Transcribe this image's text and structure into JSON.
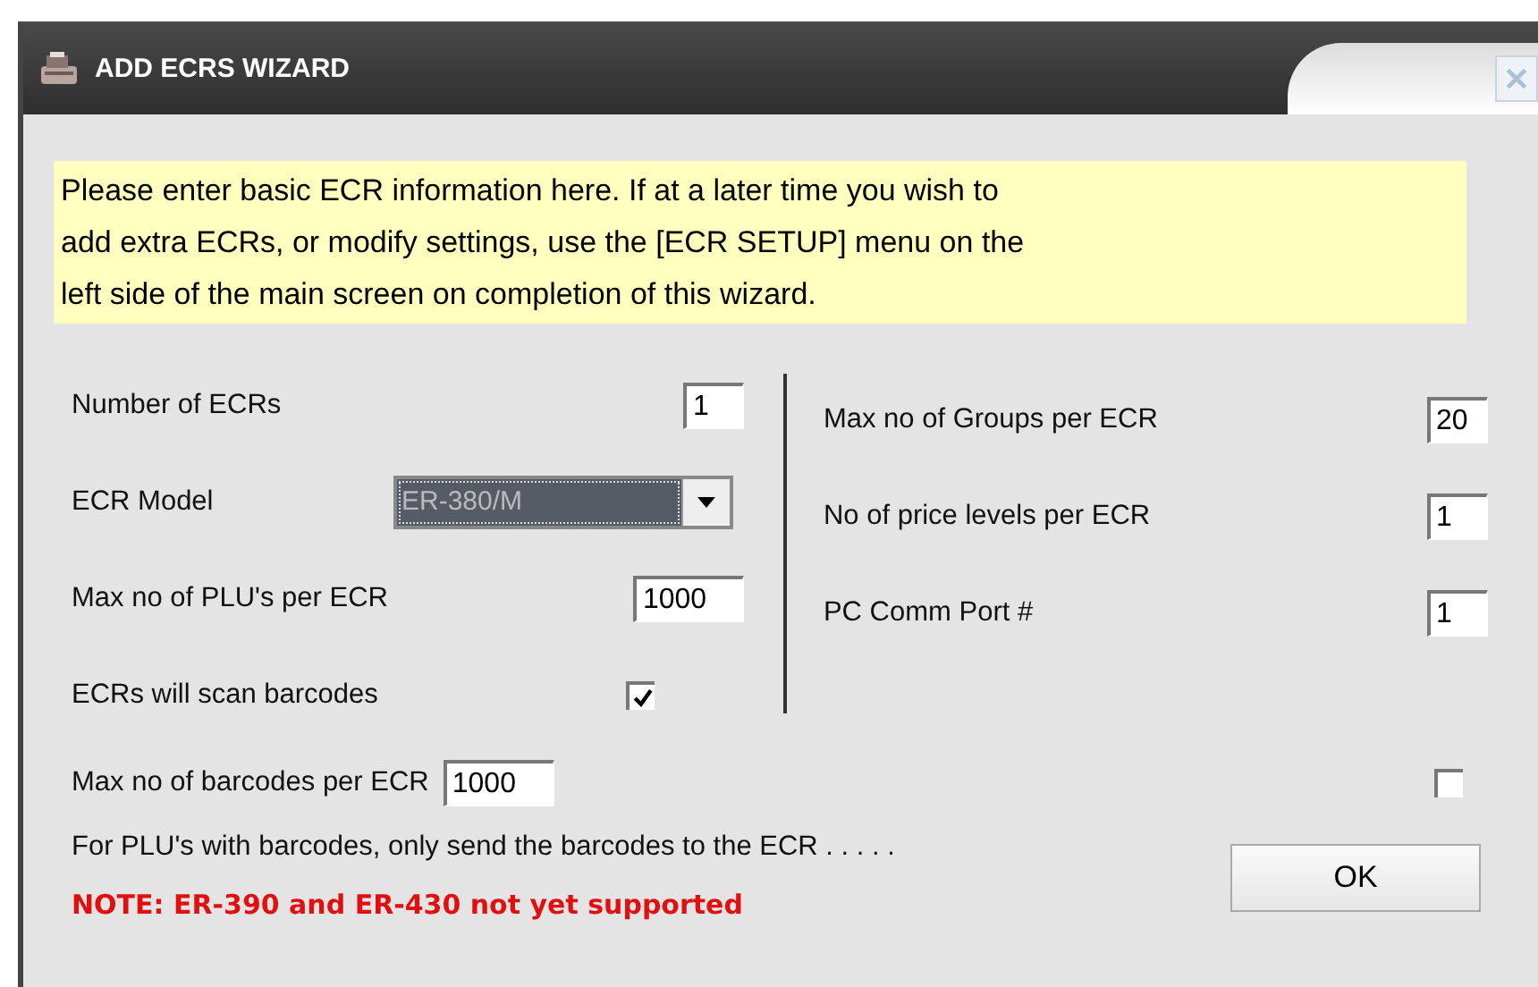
{
  "window": {
    "title": "ADD ECRS WIZARD"
  },
  "intro_lines": [
    "Please enter basic ECR information here. If at a later time you wish to",
    "add extra ECRs, or modify settings, use the [ECR SETUP] menu on the",
    "left side of the main screen on completion of this wizard."
  ],
  "left_fields": [
    {
      "kind": "text",
      "label": "Number of ECRs",
      "value": "1"
    },
    {
      "kind": "select",
      "label": "ECR Model",
      "value": "ER-380/M"
    },
    {
      "kind": "text",
      "label": "Max no of PLU's per ECR",
      "value": "1000"
    },
    {
      "kind": "checkbox",
      "label": "ECRs will scan barcodes",
      "checked": true
    }
  ],
  "right_fields": [
    {
      "kind": "text",
      "label": "Max no of Groups per ECR",
      "value": "20"
    },
    {
      "kind": "text",
      "label": "No of price levels per ECR",
      "value": "1"
    },
    {
      "kind": "text",
      "label": "PC Comm Port #",
      "value": "1"
    }
  ],
  "barcodes_field": {
    "label": "Max no of barcodes per ECR",
    "value": "1000"
  },
  "send_barcodes": {
    "label": "For PLU's with barcodes, only send the barcodes to the ECR . . . . .",
    "checked": false
  },
  "ok_button": "OK",
  "note": "NOTE: ER-390 and ER-430 not yet supported"
}
